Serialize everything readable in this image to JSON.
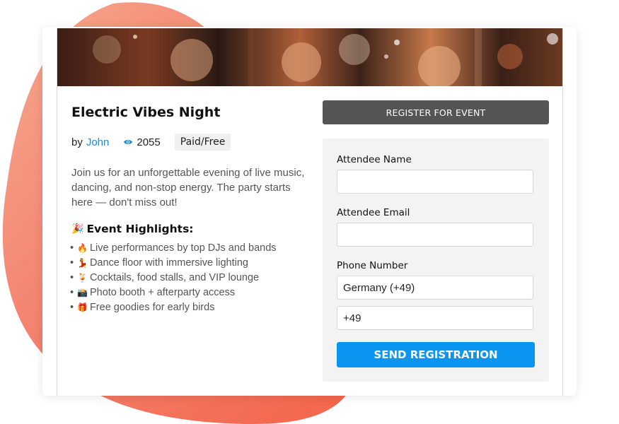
{
  "event": {
    "title": "Electric Vibes Night",
    "by_label": "by",
    "author": "John",
    "views": "2055",
    "price_badge": "Paid/Free",
    "description": "Join us for an unforgettable evening of live music, dancing, and non-stop energy. The party starts here — don't miss out!",
    "highlights_icon": "🎉",
    "highlights_title": "Event Highlights:",
    "highlights": [
      {
        "icon": "🔥",
        "text": "Live performances by top DJs and bands"
      },
      {
        "icon": "💃",
        "text": "Dance floor with immersive lighting"
      },
      {
        "icon": "🍹",
        "text": "Cocktails, food stalls, and VIP lounge"
      },
      {
        "icon": "📸",
        "text": "Photo booth + afterparty access"
      },
      {
        "icon": "🎁",
        "text": "Free goodies for early birds"
      }
    ]
  },
  "register_button": "REGISTER FOR EVENT",
  "form": {
    "name_label": "Attendee Name",
    "name_value": "",
    "email_label": "Attendee Email",
    "email_value": "",
    "phone_label": "Phone Number",
    "country_value": "Germany (+49)",
    "phone_value": "+49",
    "submit": "SEND REGISTRATION"
  },
  "colors": {
    "accent": "#0a96f0",
    "register_bg": "#555555",
    "link": "#1a8de0",
    "blob": "#f26a4f"
  },
  "icons": {
    "views": "eye-icon",
    "banner": "concert-crowd-image"
  }
}
